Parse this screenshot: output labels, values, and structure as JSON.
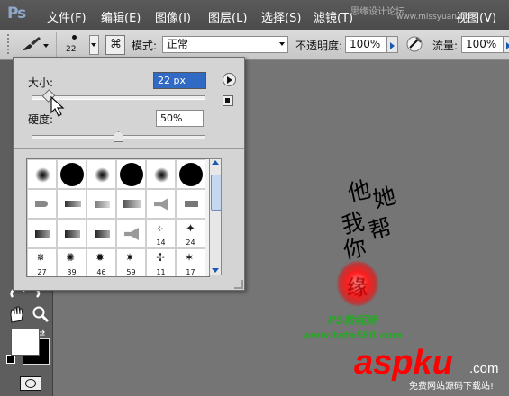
{
  "menubar": {
    "logo": "Ps",
    "items": [
      "文件(F)",
      "编辑(E)",
      "图像(I)",
      "图层(L)",
      "选择(S)",
      "滤镜(T)",
      "视图(V)"
    ],
    "overlay_text": "思缘设计论坛",
    "overlay_url": "www.missyuan.com"
  },
  "options": {
    "size_value": "22",
    "mode_label": "模式:",
    "mode_value": "正常",
    "opacity_label": "不透明度:",
    "opacity_value": "100%",
    "flow_label": "流量:",
    "flow_value": "100%"
  },
  "brush_panel": {
    "size_label": "大小:",
    "size_value": "22 px",
    "hardness_label": "硬度:",
    "hardness_value": "50%",
    "size_slider_fraction": 0.09,
    "hardness_slider_fraction": 0.5,
    "numbers": [
      "14",
      "24",
      "27",
      "39",
      "46",
      "59",
      "11",
      "17"
    ]
  },
  "canvas": {
    "calligraphy": [
      "他",
      "她",
      "我",
      "帮",
      "你"
    ],
    "seal_text": "缘",
    "site_title": "PS教程网",
    "site_url": "www.tata580.com"
  },
  "watermark": {
    "brand": "aspku",
    "suffix": ".com",
    "tagline": "免费网站源码下载站!"
  },
  "colors": {
    "brand_red": "#ff0000",
    "panel_bg": "#d4d4d4",
    "selection_blue": "#1c58b0"
  }
}
